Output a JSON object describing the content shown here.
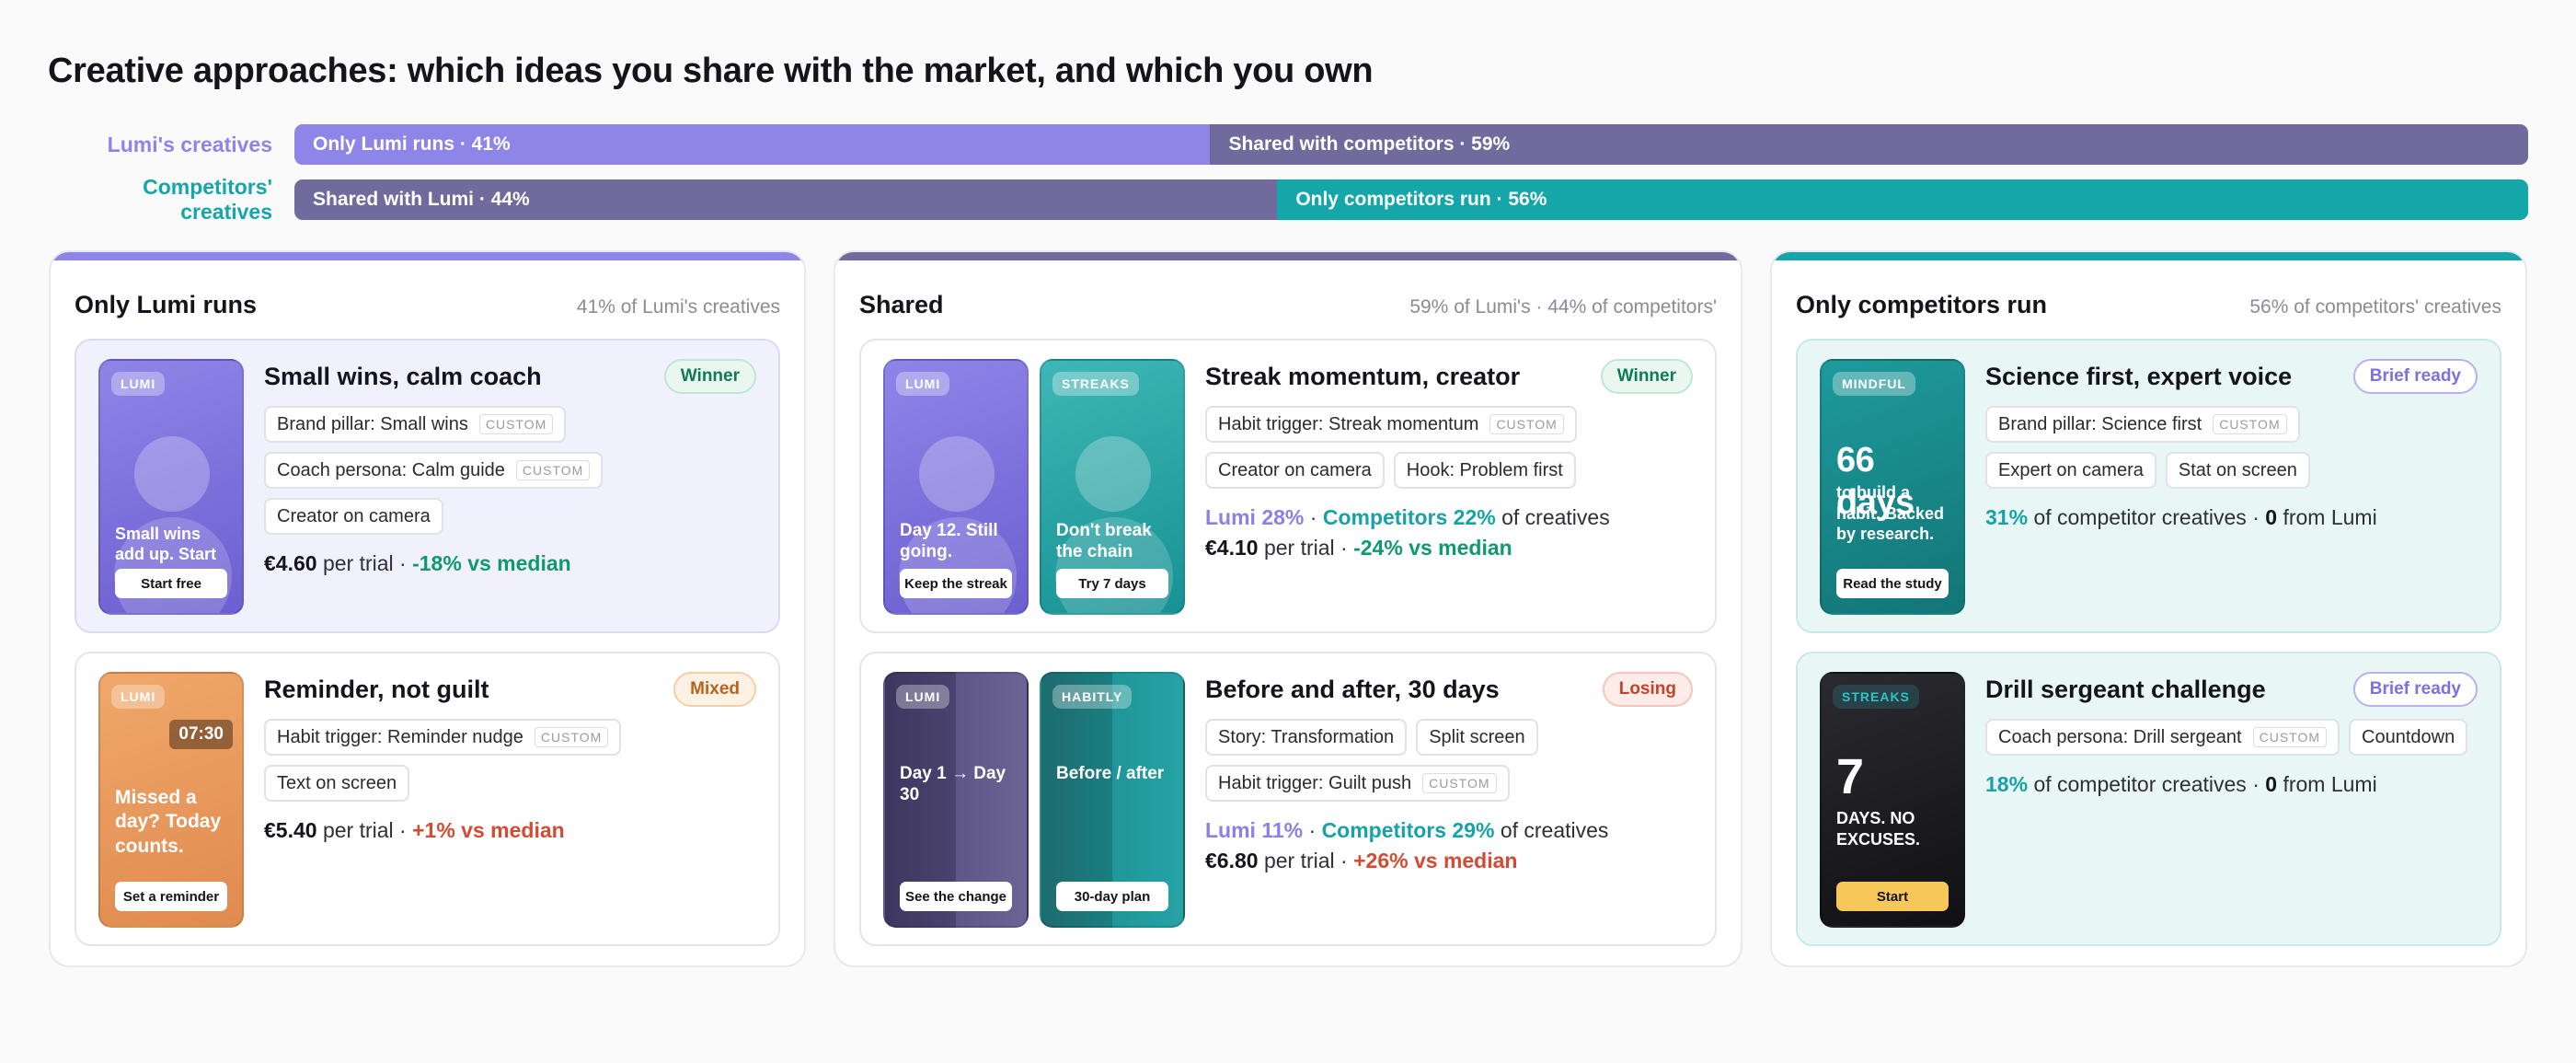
{
  "title": "Creative approaches: which ideas you share with the market, and which you own",
  "colors": {
    "lumi": "#8e85e8",
    "shared": "#716a9c",
    "competitor": "#14a6a9",
    "winner": "#0f9a6e",
    "losing": "#d44a32",
    "mixed": "#d07a28"
  },
  "bars": {
    "lumi": {
      "label": "Lumi's creatives",
      "only": "Only Lumi runs · 41%",
      "only_pct": 41,
      "shared": "Shared with competitors · 59%",
      "shared_pct": 59
    },
    "competitors": {
      "label": "Competitors' creatives",
      "shared": "Shared with Lumi · 44%",
      "shared_pct": 44,
      "only": "Only competitors run · 56%",
      "only_pct": 56
    }
  },
  "panels": {
    "lumi_only": {
      "title": "Only Lumi runs",
      "subtitle": "41% of Lumi's creatives",
      "cards": [
        {
          "thumb": {
            "tag": "LUMI",
            "text": "Small wins add up. Start with…",
            "cta": "Start free"
          },
          "title": "Small wins, calm coach",
          "badge": "Winner",
          "chips": [
            {
              "text": "Brand pillar: Small wins",
              "custom": "CUSTOM"
            },
            {
              "text": "Coach persona: Calm guide",
              "custom": "CUSTOM"
            },
            {
              "text": "Creator on camera"
            }
          ],
          "price": "€4.60",
          "per_trial": "per trial",
          "sep": "·",
          "delta": "-18% vs median"
        },
        {
          "thumb": {
            "tag": "LUMI",
            "time": "07:30",
            "text": "Missed a day? Today counts.",
            "cta": "Set a reminder"
          },
          "title": "Reminder, not guilt",
          "badge": "Mixed",
          "chips": [
            {
              "text": "Habit trigger: Reminder nudge",
              "custom": "CUSTOM"
            },
            {
              "text": "Text on screen"
            }
          ],
          "price": "€5.40",
          "per_trial": "per trial",
          "sep": "·",
          "delta": "+1% vs median"
        }
      ]
    },
    "shared": {
      "title": "Shared",
      "subtitle": "59% of Lumi's · 44% of competitors'",
      "cards": [
        {
          "thumb_a": {
            "tag": "LUMI",
            "text": "Day 12. Still going.",
            "cta": "Keep the streak"
          },
          "thumb_b": {
            "tag": "STREAKS",
            "text": "Don't break the chain",
            "cta": "Try 7 days"
          },
          "title": "Streak momentum, creator",
          "badge": "Winner",
          "chips": [
            {
              "text": "Habit trigger: Streak momentum",
              "custom": "CUSTOM"
            },
            {
              "text": "Creator on camera"
            },
            {
              "text": "Hook: Problem first"
            }
          ],
          "lumi_share": "Lumi 28%",
          "comp_share": "Competitors 22%",
          "share_suffix": "of creatives",
          "sep": "·",
          "price": "€4.10",
          "per_trial": "per trial",
          "delta": "-24% vs median"
        },
        {
          "thumb_a": {
            "tag": "LUMI",
            "text": "Day 1 → Day 30",
            "cta": "See the change"
          },
          "thumb_b": {
            "tag": "HABITLY",
            "text": "Before / after",
            "cta": "30-day plan"
          },
          "title": "Before and after, 30 days",
          "badge": "Losing",
          "chips": [
            {
              "text": "Story: Transformation"
            },
            {
              "text": "Split screen"
            },
            {
              "text": "Habit trigger: Guilt push",
              "custom": "CUSTOM"
            }
          ],
          "lumi_share": "Lumi 11%",
          "comp_share": "Competitors 29%",
          "share_suffix": "of creatives",
          "sep": "·",
          "price": "€6.80",
          "per_trial": "per trial",
          "delta": "+26% vs median"
        }
      ]
    },
    "comp_only": {
      "title": "Only competitors run",
      "subtitle": "56% of competitors' creatives",
      "cards": [
        {
          "thumb": {
            "tag": "MINDFUL",
            "big": "66 days",
            "text": "to build a habit. Backed by research.",
            "cta": "Read the study"
          },
          "title": "Science first, expert voice",
          "badge": "Brief ready",
          "chips": [
            {
              "text": "Brand pillar: Science first",
              "custom": "CUSTOM"
            },
            {
              "text": "Expert on camera"
            },
            {
              "text": "Stat on screen"
            }
          ],
          "pct": "31%",
          "of_text": "of competitor creatives",
          "sep": "·",
          "zero": "0",
          "from": "from Lumi"
        },
        {
          "thumb": {
            "tag": "STREAKS",
            "big": "7",
            "text": "DAYS. NO EXCUSES.",
            "cta": "Start"
          },
          "title": "Drill sergeant challenge",
          "badge": "Brief ready",
          "chips": [
            {
              "text": "Coach persona: Drill sergeant",
              "custom": "CUSTOM"
            },
            {
              "text": "Countdown"
            }
          ],
          "pct": "18%",
          "of_text": "of competitor creatives",
          "sep": "·",
          "zero": "0",
          "from": "from Lumi"
        }
      ]
    }
  }
}
